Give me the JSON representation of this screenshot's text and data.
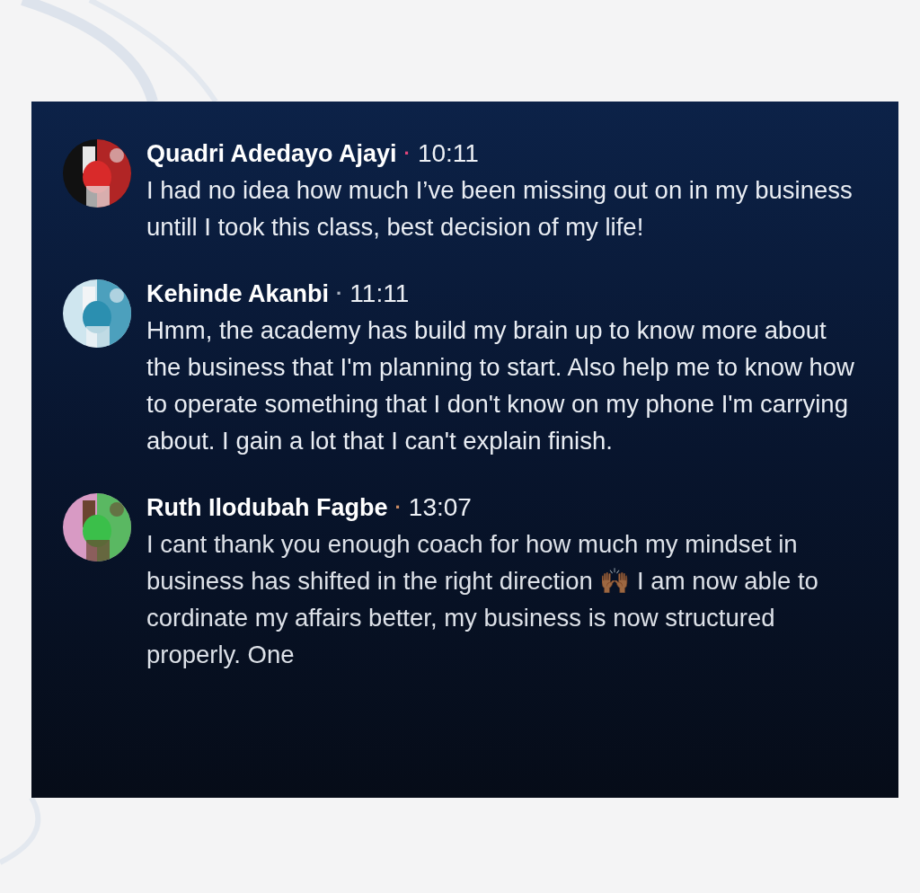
{
  "comments": [
    {
      "author": "Quadri Adedayo Ajayi",
      "separator": "·",
      "color": "#e0457a",
      "time": "10:11",
      "text": "I had no idea how much I’ve been missing out on in my business untill I took this class, best decision of my life!"
    },
    {
      "author": "Kehinde Akanbi",
      "separator": "·",
      "color": "#a9b0bd",
      "time": "11:11",
      "text": "Hmm, the academy has build my brain up to know more about the business that I'm planning to start. Also help me to know how to operate something that I don't know on my phone I'm carrying about. I gain a lot that I can't explain finish."
    },
    {
      "author": "Ruth Ilodubah Fagbe",
      "separator": "·",
      "color": "#c98a62",
      "time": "13:07",
      "text": "I cant thank you enough coach for how much my mindset in business has shifted in the right direction 🙌🏾 I am now able to cordinate my affairs better, my business is now structured properly. One"
    }
  ]
}
